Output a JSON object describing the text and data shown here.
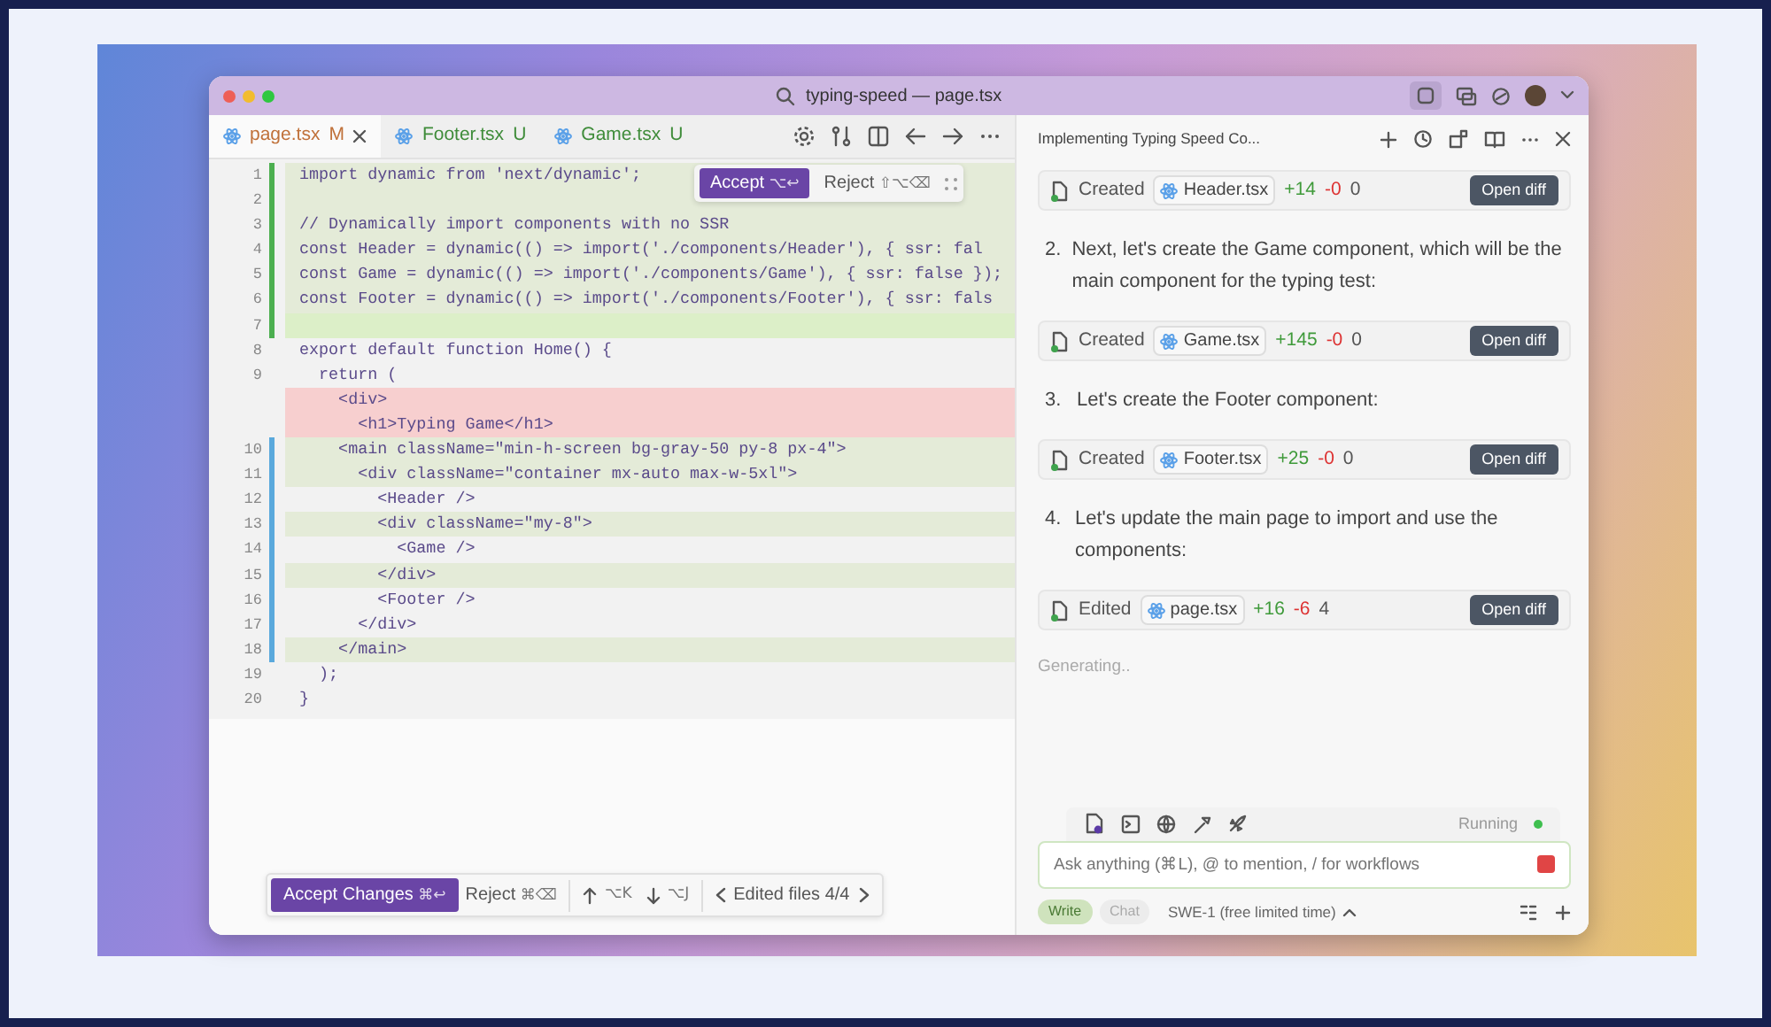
{
  "window": {
    "title": "typing-speed — page.tsx"
  },
  "tabs": [
    {
      "label": "page.tsx",
      "status": "M",
      "kind": "modified",
      "selected": true
    },
    {
      "label": "Footer.tsx",
      "status": "U",
      "kind": "untracked",
      "selected": false
    },
    {
      "label": "Game.tsx",
      "status": "U",
      "kind": "untracked",
      "selected": false
    }
  ],
  "inline_actions": {
    "accept": "Accept",
    "accept_keys": "⌥↩",
    "reject": "Reject",
    "reject_keys": "⇧⌥⌫"
  },
  "code_lines": [
    {
      "number": "1",
      "code": "import dynamic from 'next/dynamic';",
      "kind": "added",
      "highlighted": true,
      "selected": false
    },
    {
      "number": "2",
      "kind": "added",
      "highlighted": true,
      "selected": false
    },
    {
      "number": "3",
      "code": "// Dynamically import components with no SSR",
      "kind": "added",
      "highlighted": true,
      "selected": false
    },
    {
      "number": "4",
      "code": "const Header = dynamic(() => import('./components/Header'), { ssr: fal",
      "kind": "added",
      "highlighted": true,
      "selected": false
    },
    {
      "number": "5",
      "code": "const Game = dynamic(() => import('./components/Game'), { ssr: false });",
      "kind": "added",
      "highlighted": true,
      "selected": false
    },
    {
      "number": "6",
      "code": "const Footer = dynamic(() => import('./components/Footer'), { ssr: fals",
      "kind": "added",
      "highlighted": true,
      "selected": false
    },
    {
      "number": "7",
      "kind": "added",
      "highlighted": true,
      "selected": true
    },
    {
      "number": "8",
      "code": "export default function Home() {",
      "kind": "context",
      "highlighted": false,
      "selected": false
    },
    {
      "number": "9",
      "code": "  return (",
      "kind": "context",
      "highlighted": false,
      "selected": false
    },
    {
      "code": "    <div>",
      "kind": "removed",
      "highlighted": true,
      "selected": false
    },
    {
      "code": "      <h1>Typing Game</h1>",
      "kind": "removed",
      "highlighted": true,
      "selected": false
    },
    {
      "number": "10",
      "code": "    <main className=\"min-h-screen bg-gray-50 py-8 px-4\">",
      "kind": "modified",
      "highlighted": true,
      "selected": false
    },
    {
      "number": "11",
      "code": "      <div className=\"container mx-auto max-w-5xl\">",
      "kind": "modified",
      "highlighted": true,
      "selected": false
    },
    {
      "number": "12",
      "code": "        <Header />",
      "kind": "modified",
      "highlighted": false,
      "selected": false
    },
    {
      "number": "13",
      "code": "        <div className=\"my-8\">",
      "kind": "modified",
      "highlighted": true,
      "selected": false
    },
    {
      "number": "14",
      "code": "          <Game />",
      "kind": "modified",
      "highlighted": false,
      "selected": false
    },
    {
      "number": "15",
      "code": "        </div>",
      "kind": "modified",
      "highlighted": true,
      "selected": false
    },
    {
      "number": "16",
      "code": "        <Footer />",
      "kind": "modified",
      "highlighted": false,
      "selected": false
    },
    {
      "number": "17",
      "code": "      </div>",
      "kind": "modified",
      "highlighted": false,
      "selected": false
    },
    {
      "number": "18",
      "code": "    </main>",
      "kind": "modified",
      "highlighted": true,
      "selected": false
    },
    {
      "number": "19",
      "code": "  );",
      "kind": "context",
      "highlighted": false,
      "selected": false
    },
    {
      "number": "20",
      "code": "}",
      "kind": "context",
      "highlighted": false,
      "selected": false
    }
  ],
  "review_bar": {
    "accept": "Accept Changes",
    "accept_keys": "⌘↩",
    "reject": "Reject",
    "reject_keys": "⌘⌫",
    "prev_keys": "⌥K",
    "next_keys": "⌥J",
    "files": "Edited files 4/4"
  },
  "chat": {
    "title": "Implementing Typing Speed Co...",
    "items": [
      {
        "kind": "file",
        "action": "Created",
        "file": "Header.tsx",
        "added": "+14",
        "removed": "-0",
        "count": "0",
        "button": "Open diff"
      },
      {
        "kind": "step",
        "number": "2.",
        "text": "Next, let's create the Game component, which will be the main component for the typing test:"
      },
      {
        "kind": "file",
        "action": "Created",
        "file": "Game.tsx",
        "added": "+145",
        "removed": "-0",
        "count": "0",
        "button": "Open diff"
      },
      {
        "kind": "step",
        "number": "3.",
        "text": "Let's create the Footer component:"
      },
      {
        "kind": "file",
        "action": "Created",
        "file": "Footer.tsx",
        "added": "+25",
        "removed": "-0",
        "count": "0",
        "button": "Open diff"
      },
      {
        "kind": "step",
        "number": "4.",
        "text": "Let's update the main page to import and use the components:"
      },
      {
        "kind": "file",
        "action": "Edited",
        "file": "page.tsx",
        "added": "+16",
        "removed": "-6",
        "count": "4",
        "button": "Open diff"
      }
    ],
    "generating": "Generating..",
    "status": {
      "label": "Running",
      "color": "#3fbf4f"
    },
    "input": {
      "placeholder": "Ask anything (⌘L), @ to mention, / for workflows"
    },
    "modes": [
      {
        "label": "Write",
        "selected": true
      },
      {
        "label": "Chat",
        "selected": false
      }
    ],
    "model": "SWE-1 (free limited time)"
  }
}
